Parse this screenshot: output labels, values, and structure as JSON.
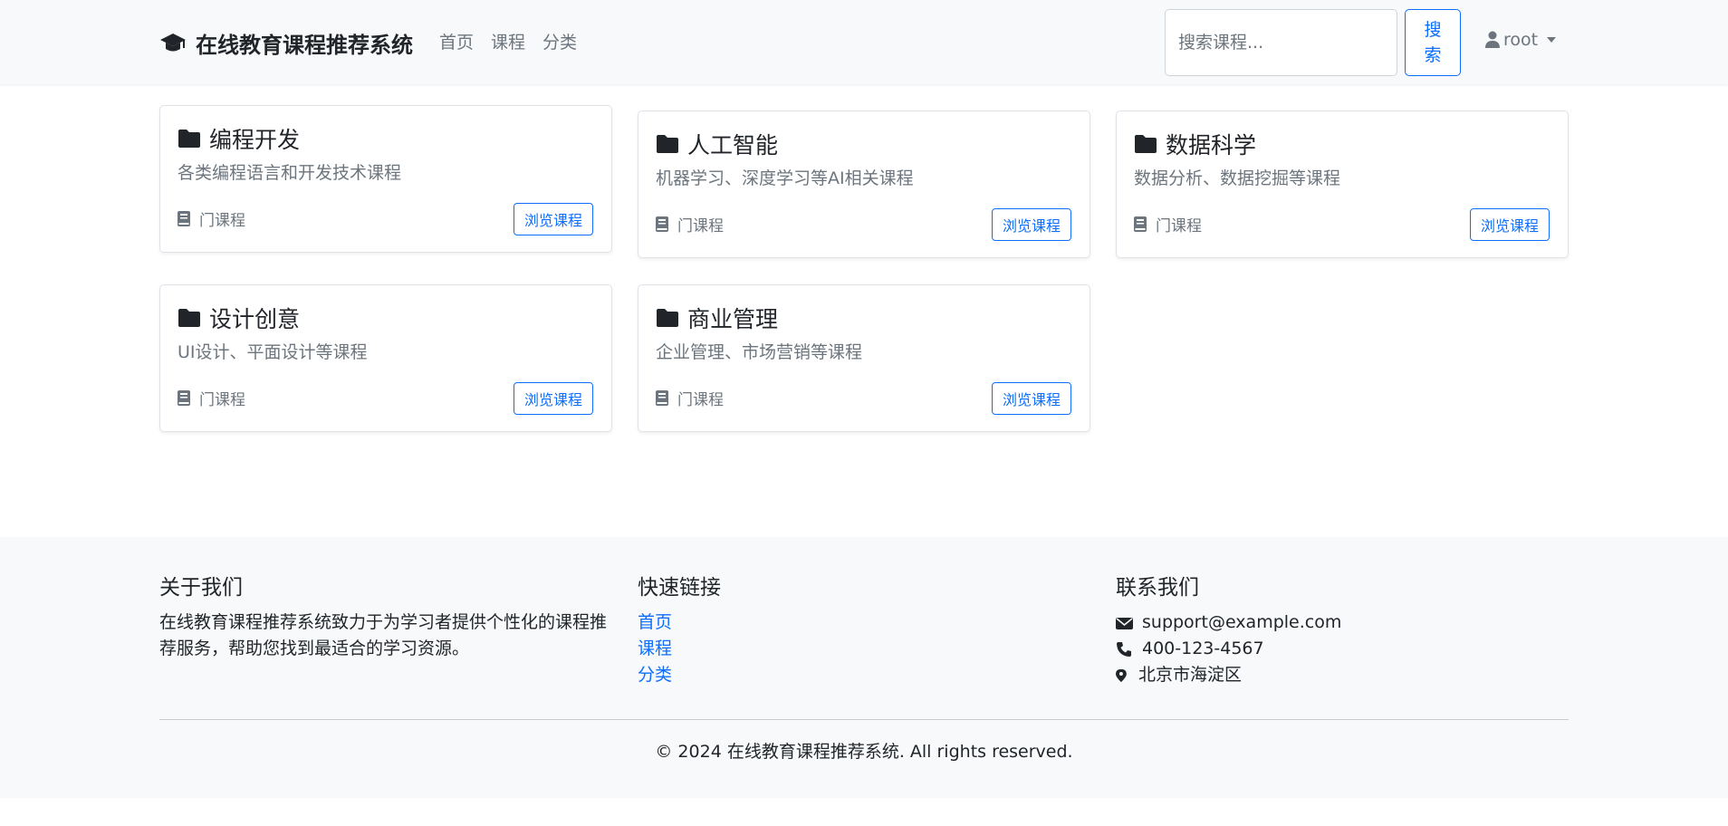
{
  "navbar": {
    "brand": "在线教育课程推荐系统",
    "brand_icon": "graduation-cap-icon",
    "links": [
      "首页",
      "课程",
      "分类"
    ],
    "search_placeholder": "搜索课程...",
    "search_button": "搜索",
    "user": "root"
  },
  "categories": [
    {
      "title": "编程开发",
      "description": "各类编程语言和开发技术课程",
      "count_label": "门课程",
      "button": "浏览课程"
    },
    {
      "title": "人工智能",
      "description": "机器学习、深度学习等AI相关课程",
      "count_label": "门课程",
      "button": "浏览课程"
    },
    {
      "title": "数据科学",
      "description": "数据分析、数据挖掘等课程",
      "count_label": "门课程",
      "button": "浏览课程"
    },
    {
      "title": "设计创意",
      "description": "UI设计、平面设计等课程",
      "count_label": "门课程",
      "button": "浏览课程"
    },
    {
      "title": "商业管理",
      "description": "企业管理、市场营销等课程",
      "count_label": "门课程",
      "button": "浏览课程"
    }
  ],
  "footer": {
    "about_heading": "关于我们",
    "about_text": "在线教育课程推荐系统致力于为学习者提供个性化的课程推荐服务，帮助您找到最适合的学习资源。",
    "links_heading": "快速链接",
    "links": [
      "首页",
      "课程",
      "分类"
    ],
    "contact_heading": "联系我们",
    "email": "support@example.com",
    "phone": "400-123-4567",
    "address": "北京市海淀区",
    "copyright": "© 2024 在线教育课程推荐系统. All rights reserved."
  },
  "colors": {
    "primary": "#0d6efd",
    "muted": "#6c757d",
    "navbar_bg": "#f8f9fa",
    "footer_bg": "#f8f9fa"
  }
}
